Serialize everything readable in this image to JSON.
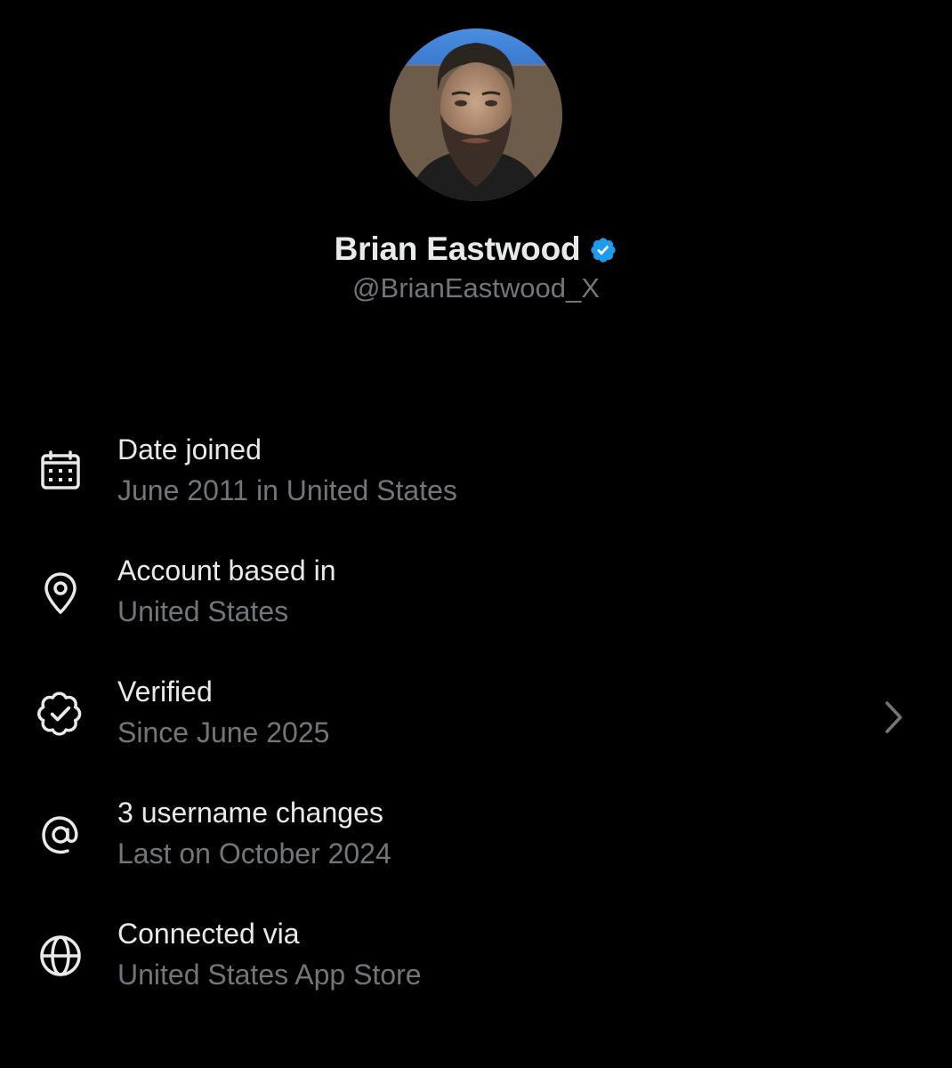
{
  "profile": {
    "display_name": "Brian Eastwood",
    "handle": "@BrianEastwood_X",
    "verified": true,
    "verified_color": "#1d9bf0"
  },
  "info_items": [
    {
      "icon": "calendar-icon",
      "title": "Date joined",
      "subtitle": "June 2011 in United States"
    },
    {
      "icon": "location-pin-icon",
      "title": "Account based in",
      "subtitle": "United States"
    },
    {
      "icon": "verified-badge-outline-icon",
      "title": "Verified",
      "subtitle": "Since June 2025",
      "has_chevron": true
    },
    {
      "icon": "at-sign-icon",
      "title": "3 username changes",
      "subtitle": "Last on October 2024"
    },
    {
      "icon": "globe-icon",
      "title": "Connected via",
      "subtitle": "United States App Store"
    }
  ],
  "colors": {
    "background": "#000000",
    "primary_text": "#e7e9ea",
    "secondary_text": "#71767b",
    "icon": "#e7e9ea"
  }
}
